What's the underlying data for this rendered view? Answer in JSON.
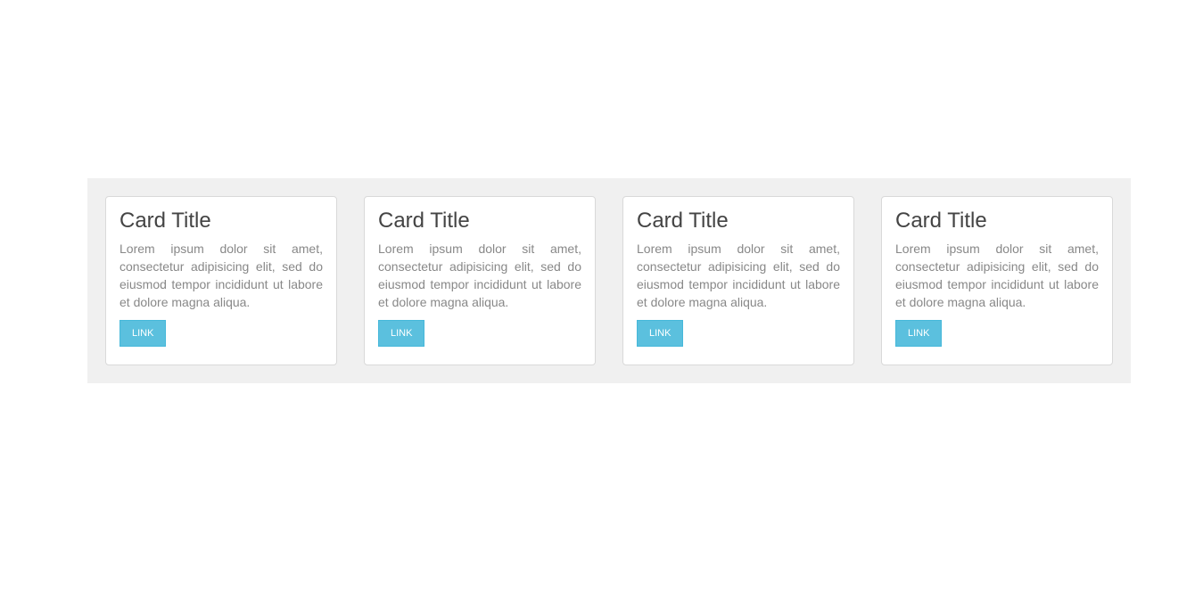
{
  "cards": [
    {
      "title": "Card Title",
      "text": "Lorem ipsum dolor sit amet, consectetur adipisicing elit, sed do eiusmod tempor incididunt ut labore et dolore magna aliqua.",
      "button_label": "LINK"
    },
    {
      "title": "Card Title",
      "text": "Lorem ipsum dolor sit amet, consectetur adipisicing elit, sed do eiusmod tempor incididunt ut labore et dolore magna aliqua.",
      "button_label": "LINK"
    },
    {
      "title": "Card Title",
      "text": "Lorem ipsum dolor sit amet, consectetur adipisicing elit, sed do eiusmod tempor incididunt ut labore et dolore magna aliqua.",
      "button_label": "LINK"
    },
    {
      "title": "Card Title",
      "text": "Lorem ipsum dolor sit amet, consectetur adipisicing elit, sed do eiusmod tempor incididunt ut labore et dolore magna aliqua.",
      "button_label": "LINK"
    }
  ],
  "colors": {
    "button": "#5bc0de",
    "band_background": "#f0f0f0",
    "title": "#444444",
    "text": "#888888"
  }
}
